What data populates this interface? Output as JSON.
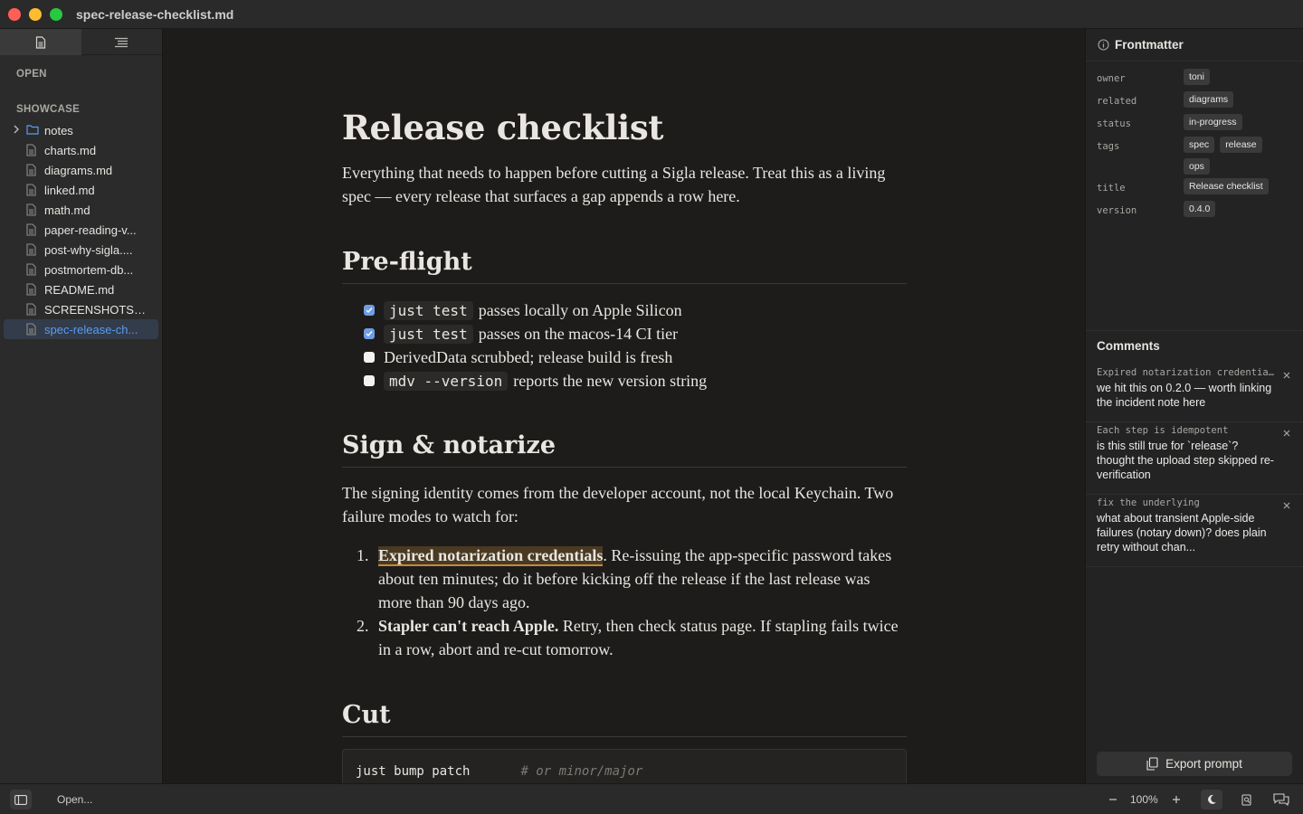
{
  "window": {
    "title": "spec-release-checklist.md"
  },
  "sidebar": {
    "tabs": [
      "files",
      "outline"
    ],
    "open_label": "OPEN",
    "section_label": "SHOWCASE",
    "folder": "notes",
    "files": [
      "charts.md",
      "diagrams.md",
      "linked.md",
      "math.md",
      "paper-reading-v...",
      "post-why-sigla....",
      "postmortem-db...",
      "README.md",
      "SCREENSHOTS....",
      "spec-release-ch..."
    ],
    "selected_index": 9
  },
  "doc": {
    "title": "Release checklist",
    "intro": "Everything that needs to happen before cutting a Sigla release. Treat this as a living spec — every release that surfaces a gap appends a row here.",
    "h_preflight": "Pre-flight",
    "checks": [
      {
        "done": true,
        "code": "just test",
        "text": "passes locally on Apple Silicon"
      },
      {
        "done": true,
        "code": "just test",
        "text": "passes on the macos-14 CI tier"
      },
      {
        "done": false,
        "code": "",
        "text": "DerivedData scrubbed; release build is fresh"
      },
      {
        "done": false,
        "code": "mdv --version",
        "text": "reports the new version string"
      }
    ],
    "h_sign": "Sign & notarize",
    "sign_intro": "The signing identity comes from the developer account, not the local Keychain. Two failure modes to watch for:",
    "steps": [
      {
        "num": "1.",
        "bold": "Expired notarization credentials",
        "rest": ". Re-issuing the app-specific password takes about ten minutes; do it before kicking off the release if the last release was more than 90 days ago."
      },
      {
        "num": "2.",
        "bold": "Stapler can't reach Apple.",
        "rest": " Retry, then check status page. If stapling fails twice in a row, abort and re-cut tomorrow."
      }
    ],
    "h_cut": "Cut",
    "code_cmd": "just bump patch",
    "code_comment": "# or minor/major"
  },
  "frontmatter": {
    "heading": "Frontmatter",
    "rows": [
      {
        "key": "owner",
        "values": [
          "toni"
        ]
      },
      {
        "key": "related",
        "values": [
          "diagrams"
        ]
      },
      {
        "key": "status",
        "values": [
          "in-progress"
        ]
      },
      {
        "key": "tags",
        "values": [
          "spec",
          "release",
          "ops"
        ]
      },
      {
        "key": "title",
        "values": [
          "Release checklist"
        ]
      },
      {
        "key": "version",
        "values": [
          "0.4.0"
        ]
      }
    ]
  },
  "comments": {
    "heading": "Comments",
    "items": [
      {
        "anchor": "Expired notarization credentia...",
        "body": "we hit this on 0.2.0 — worth linking the incident note here"
      },
      {
        "anchor": "Each step is idempotent",
        "body": "is this still true for `release`? thought the upload step skipped re-verification"
      },
      {
        "anchor": "fix the underlying",
        "body": "what about transient Apple-side failures (notary down)? does plain retry without chan..."
      }
    ],
    "export_label": "Export prompt"
  },
  "statusbar": {
    "open_label": "Open...",
    "zoom": "100%"
  },
  "colors": {
    "accent": "#5a9cf0",
    "checkbox_on": "#6f9ee6",
    "highlight": "#c08a3e"
  }
}
